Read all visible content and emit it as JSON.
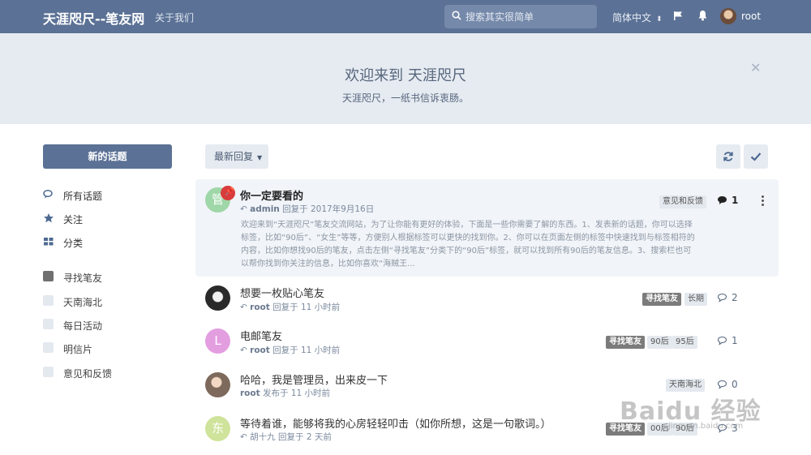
{
  "header": {
    "site_title": "天涯咫尺--笔友网",
    "about_link": "关于我们",
    "search_placeholder": "搜索其实很简单",
    "language": "简体中文",
    "user": "root"
  },
  "hero": {
    "title": "欢迎来到 天涯咫尺",
    "subtitle": "天涯咫尺，一纸书信诉衷肠。"
  },
  "sidebar": {
    "new_topic": "新的话题",
    "nav": [
      {
        "label": "所有话题",
        "icon": "comments-icon"
      },
      {
        "label": "关注",
        "icon": "star-icon"
      },
      {
        "label": "分类",
        "icon": "grid-icon"
      }
    ],
    "tags": [
      {
        "label": "寻找笔友",
        "color": "#707070"
      },
      {
        "label": "天南海北",
        "color": "#e4e9ef"
      },
      {
        "label": "每日活动",
        "color": "#e4e9ef"
      },
      {
        "label": "明信片",
        "color": "#e4e9ef"
      },
      {
        "label": "意见和反馈",
        "color": "#e4e9ef"
      }
    ]
  },
  "toolbar": {
    "sort": "最新回复"
  },
  "discussions": [
    {
      "title": "你一定要看的",
      "avatar": "管",
      "avatar_color": "#9fd7a8",
      "author": "admin",
      "action": "回复于 2017年9月16日",
      "pinned": true,
      "tags": [
        "意见和反馈"
      ],
      "replies": "1",
      "excerpt": "欢迎来到“天涯咫尺”笔友交流网站，为了让你能有更好的体验，下面是一些你需要了解的东西。1、发表新的话题，你可以选择标签，比如“90后”、“女生”等等，方便别人根据标签可以更快的找到你。2、你可以在页面左侧的标签中快速找到与标签相符的内容，比如你想找90后的笔友，点击左侧“寻找笔友”分类下的“90后”标签，就可以找到所有90后的笔友信息。3、搜索栏也可以帮你找到你关注的信息，比如你喜欢“海贼王..."
    },
    {
      "title": "想要一枚贴心笔友",
      "avatar": "",
      "author": "root",
      "action": "回复于 11 小时前",
      "tags": [
        "寻找笔友",
        "长期"
      ],
      "replies": "2"
    },
    {
      "title": "电邮笔友",
      "avatar": "L",
      "avatar_color": "#e39ee0",
      "author": "root",
      "action": "回复于 11 小时前",
      "tags": [
        "寻找笔友",
        "90后",
        "95后"
      ],
      "replies": "1"
    },
    {
      "title": "哈哈，我是管理员，出来皮一下",
      "avatar": "",
      "author": "root",
      "action": "发布于 11 小时前",
      "tags": [
        "天南海北"
      ],
      "replies": "0"
    },
    {
      "title": "等待着谁，能够将我的心房轻轻叩击（如你所想，这是一句歌词。）",
      "avatar": "东",
      "avatar_color": "#cfe39b",
      "author": "胡十九",
      "action": "回复于 2 天前",
      "tags": [
        "寻找笔友",
        "00后",
        "90后"
      ],
      "replies": "3"
    }
  ],
  "watermark": {
    "text": "Baidu 经验",
    "url": "jingyan.baidu.com"
  }
}
